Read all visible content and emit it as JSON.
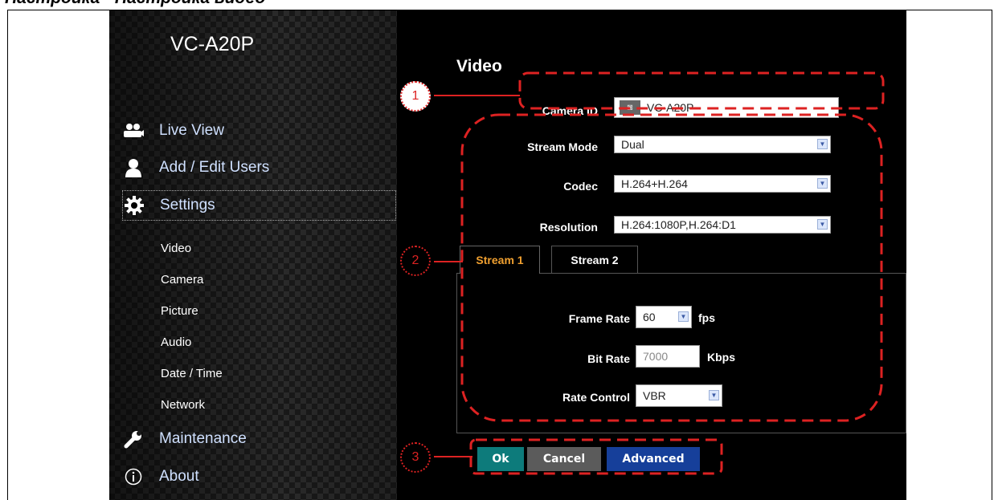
{
  "doc": {
    "heading": "Настройка - Настройка видео"
  },
  "sidebar": {
    "device_title": "VC-A20P",
    "items": [
      {
        "label": "Live View",
        "icon": "users-icon"
      },
      {
        "label": "Add / Edit Users",
        "icon": "user-icon"
      },
      {
        "label": "Settings",
        "icon": "gear-icon"
      },
      {
        "label": "Maintenance",
        "icon": "wrench-icon"
      },
      {
        "label": "About",
        "icon": "info-icon"
      }
    ],
    "settings_sub": [
      "Video",
      "Camera",
      "Picture",
      "Audio",
      "Date / Time",
      "Network"
    ]
  },
  "main": {
    "title": "Video",
    "camera_id": {
      "label": "Camera ID",
      "value": "VC-A20P"
    },
    "stream_mode": {
      "label": "Stream Mode",
      "value": "Dual"
    },
    "codec": {
      "label": "Codec",
      "value": "H.264+H.264"
    },
    "resolution": {
      "label": "Resolution",
      "value": "H.264:1080P,H.264:D1"
    },
    "tabs": [
      "Stream 1",
      "Stream 2"
    ],
    "frame_rate": {
      "label": "Frame Rate",
      "value": "60",
      "unit": "fps"
    },
    "bit_rate": {
      "label": "Bit Rate",
      "value": "7000",
      "unit": "Kbps"
    },
    "rate_control": {
      "label": "Rate Control",
      "value": "VBR"
    },
    "buttons": {
      "ok": "Ok",
      "cancel": "Cancel",
      "advanced": "Advanced"
    }
  },
  "callouts": [
    "1",
    "2",
    "3"
  ],
  "colors": {
    "callout": "#dd2222",
    "ok": "#0d7b7b",
    "cancel": "#5b5b5b",
    "advanced": "#163f9a",
    "tab_active": "#f0a030"
  }
}
